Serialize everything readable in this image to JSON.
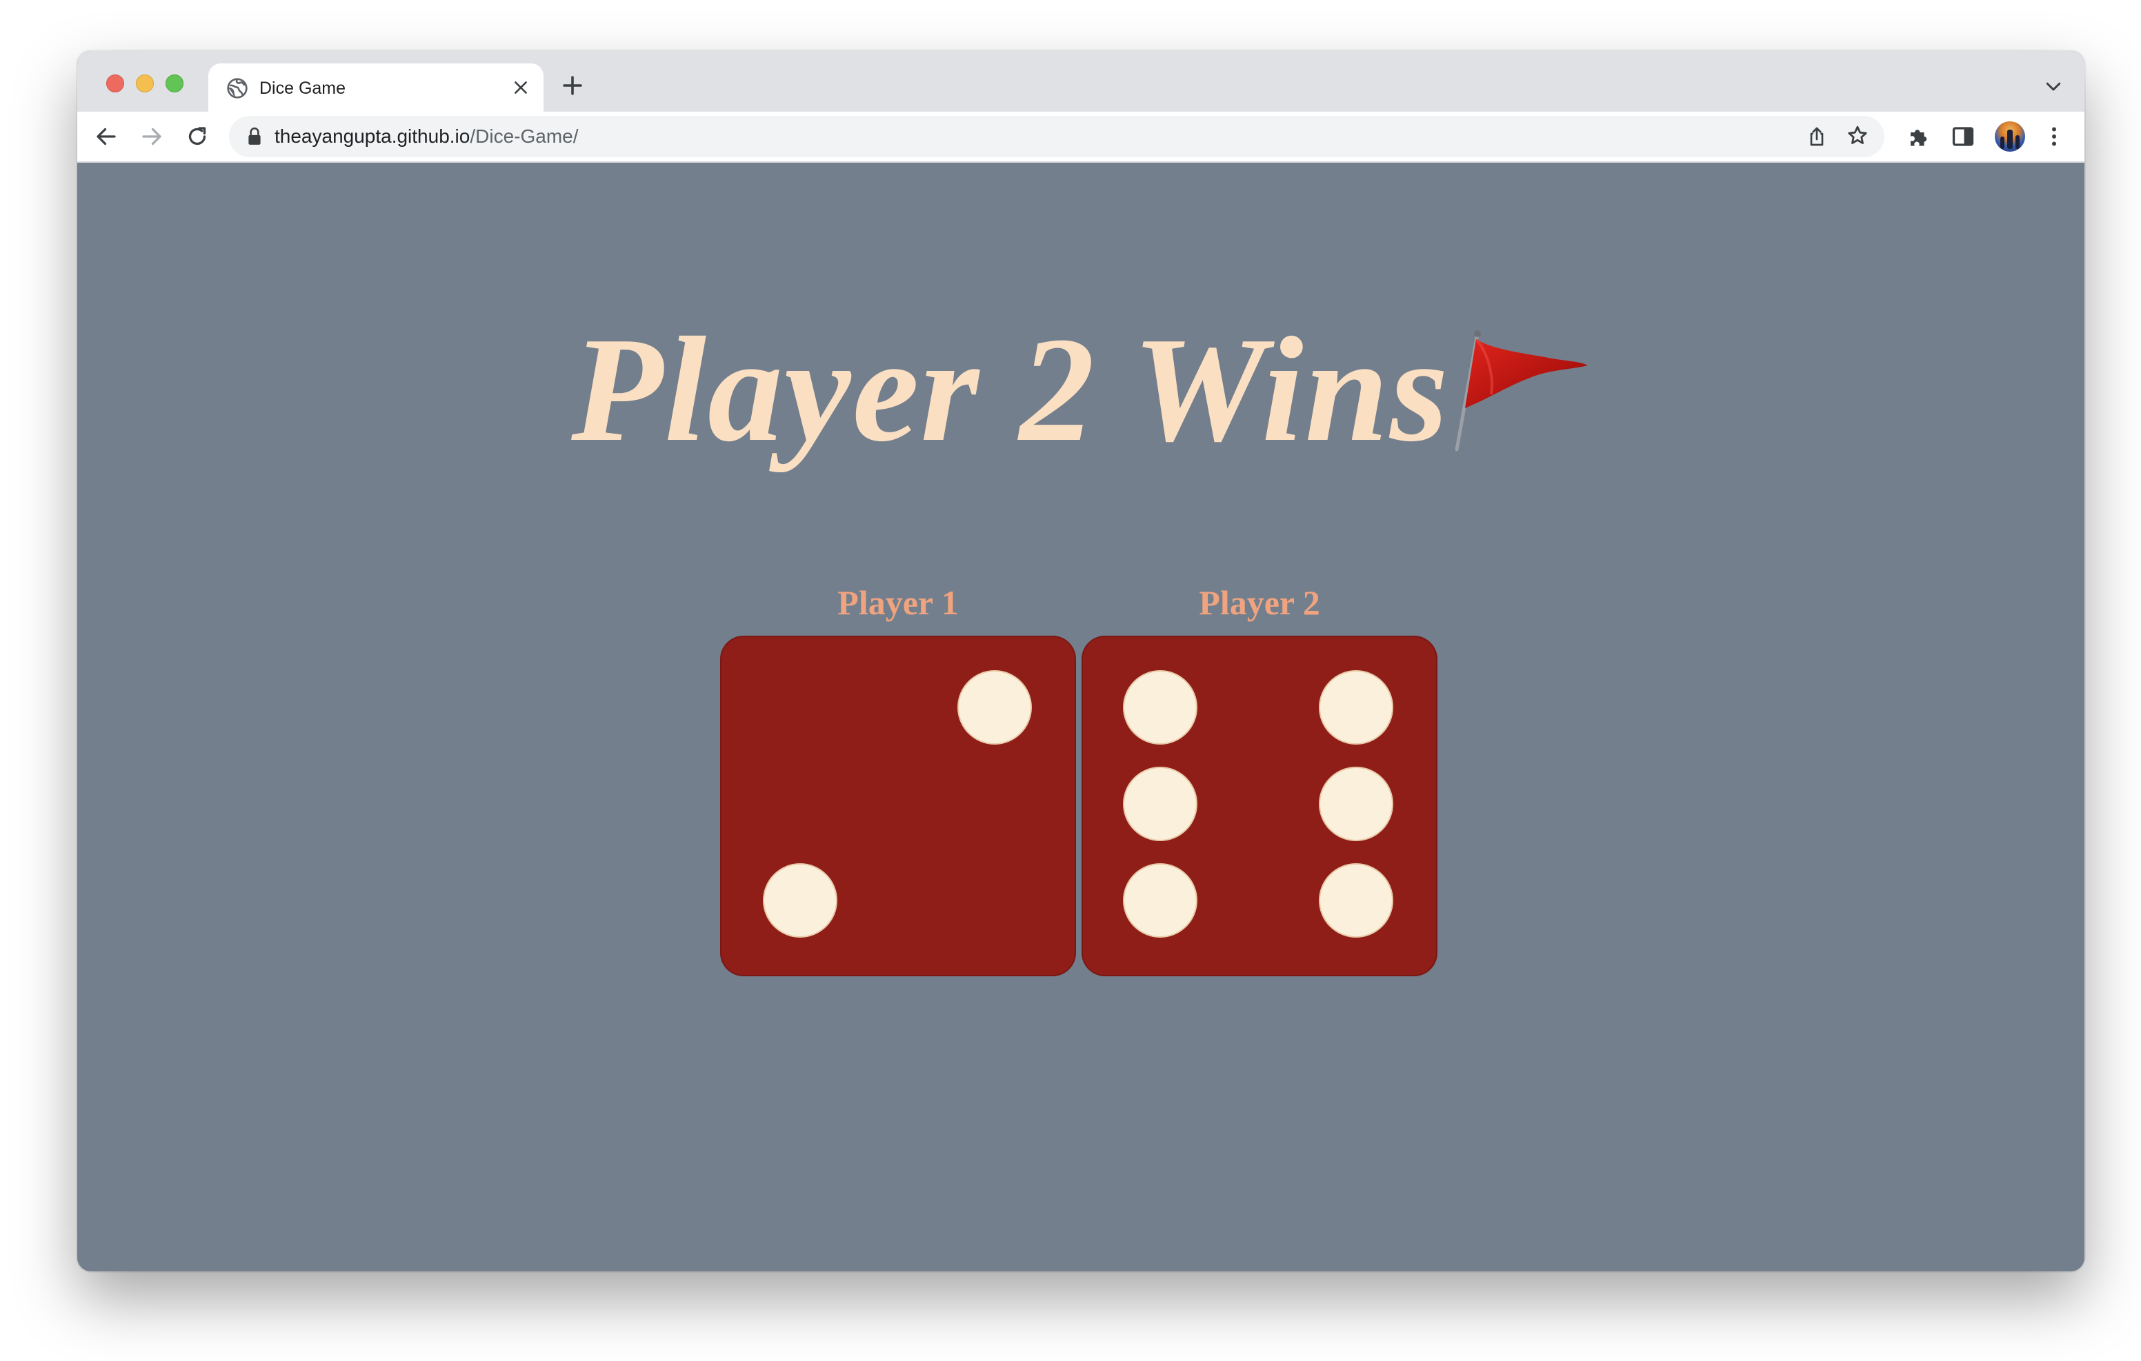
{
  "browser": {
    "tab_title": "Dice Game",
    "url_host": "theayangupta.github.io",
    "url_path": "/Dice-Game/"
  },
  "page": {
    "headline": "Player 2 Wins",
    "headline_icon": "red-flag-icon",
    "background_color": "#737f8d",
    "headline_color": "#fbdfc2",
    "player_label_color": "#f0a37f",
    "die_color": "#8f1d18",
    "pip_color": "#fbf0dc",
    "players": [
      {
        "name": "Player 1",
        "die_value": 2
      },
      {
        "name": "Player 2",
        "die_value": 6
      }
    ]
  }
}
